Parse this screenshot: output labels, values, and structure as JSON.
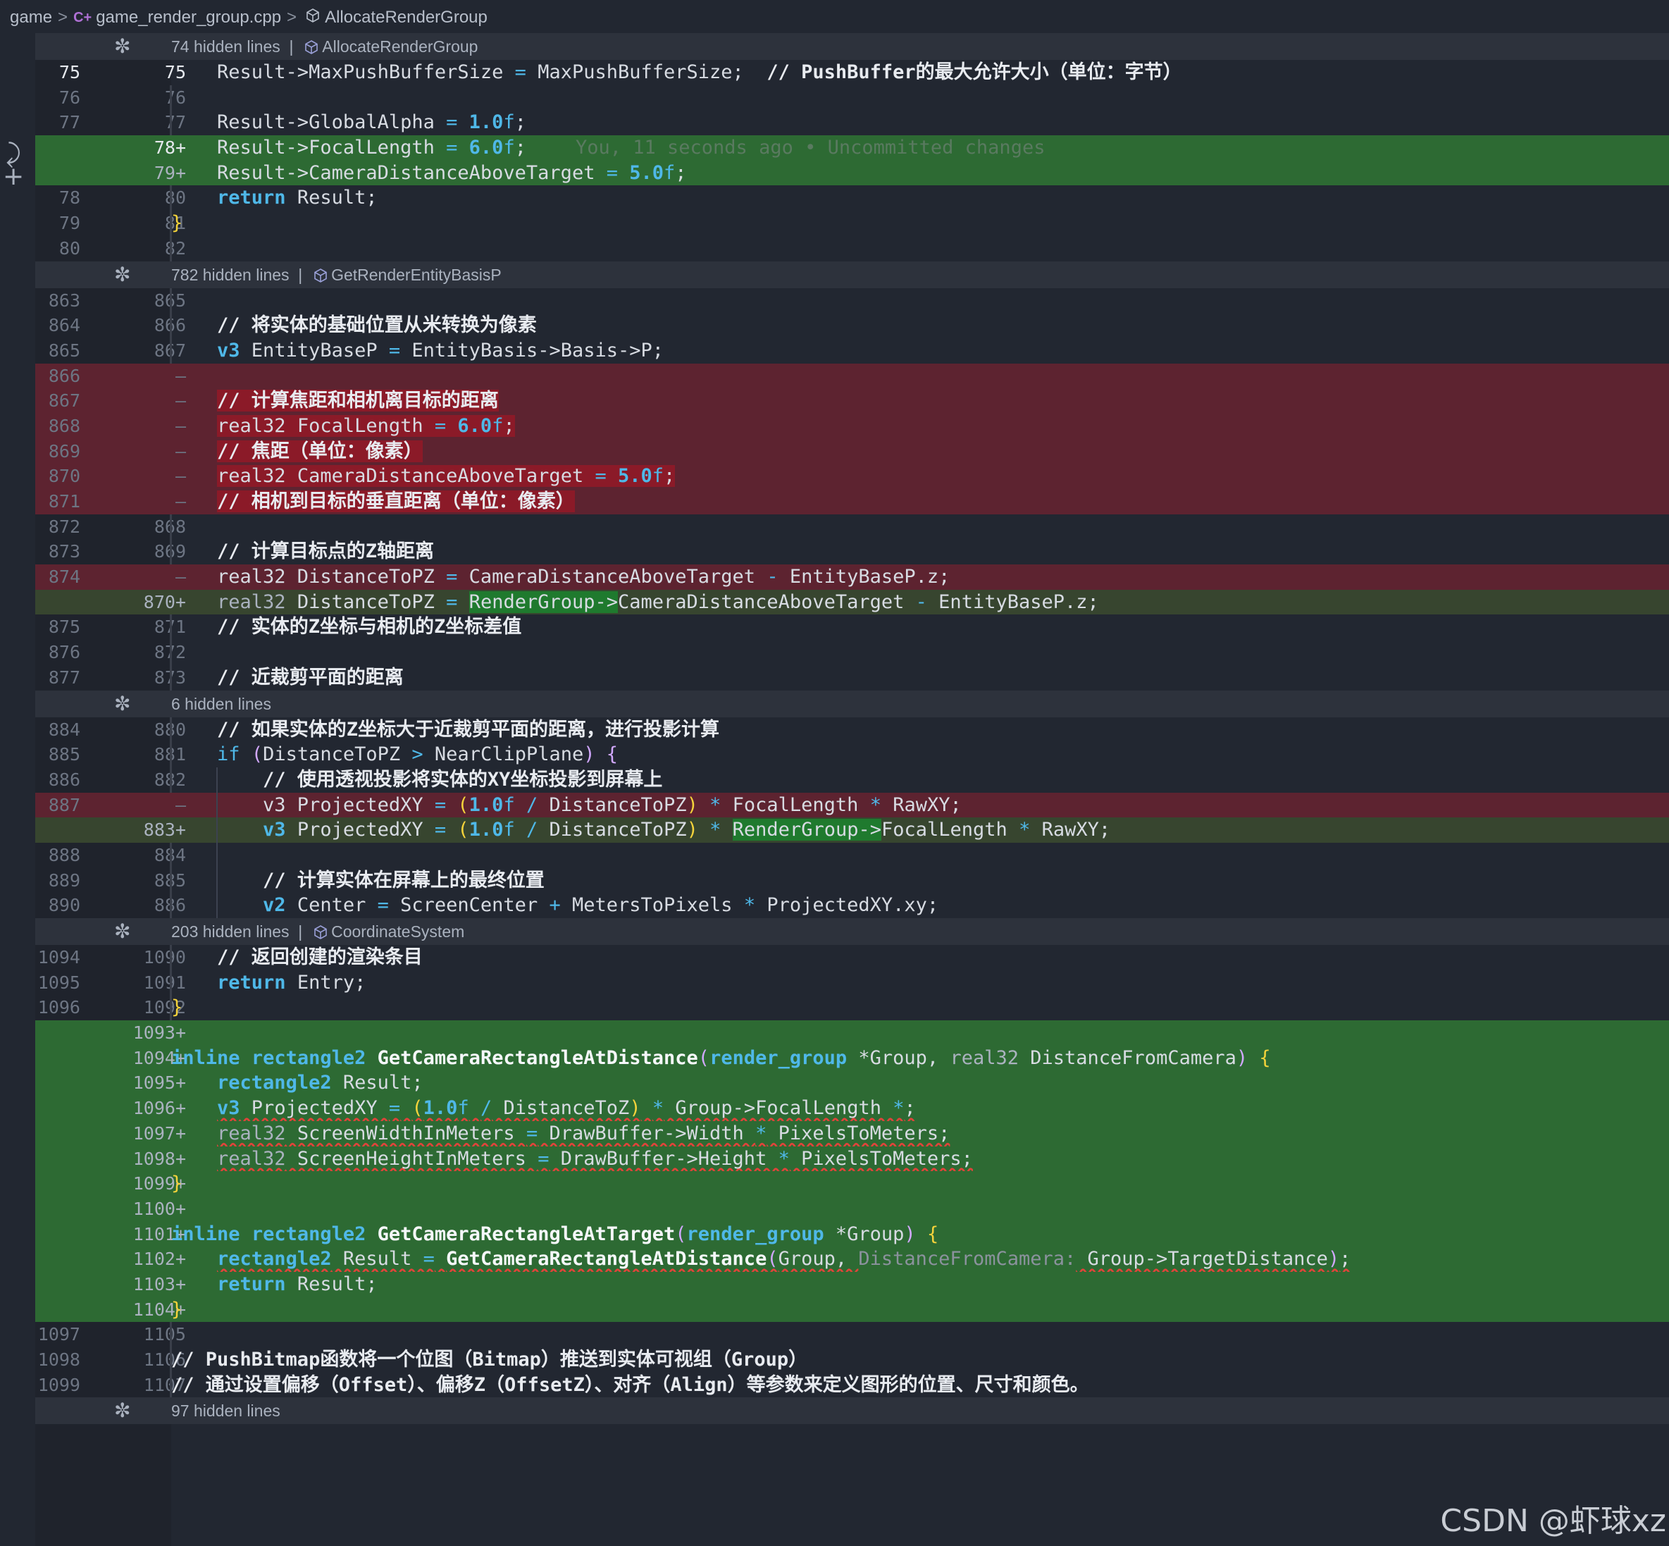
{
  "breadcrumb": {
    "folder": "game",
    "file": "game_render_group.cpp",
    "symbol": "AllocateRenderGroup"
  },
  "watermark": "CSDN @虾球xz",
  "rows": [
    {
      "type": "hidden",
      "text": "74 hidden lines",
      "symbol": "AllocateRenderGroup"
    },
    {
      "type": "ctx",
      "old": "75",
      "new": "75",
      "cur": true,
      "tokens": [
        [
          "",
          "    Result->MaxPushBufferSize "
        ],
        [
          "op",
          "="
        ],
        [
          "",
          " MaxPushBufferSize;  "
        ],
        [
          "cm",
          "// PushBuffer的最大允许大小（单位：字节）"
        ]
      ]
    },
    {
      "type": "ctx",
      "old": "76",
      "new": "76",
      "tokens": []
    },
    {
      "type": "ctx",
      "old": "77",
      "new": "77",
      "tokens": [
        [
          "",
          "    Result->GlobalAlpha "
        ],
        [
          "op",
          "="
        ],
        [
          "",
          " "
        ],
        [
          "num",
          "1.0"
        ],
        [
          "f",
          "f"
        ],
        [
          "",
          ";"
        ]
      ]
    },
    {
      "type": "add",
      "old": "",
      "new": "78+",
      "cur": true,
      "tokens": [
        [
          "",
          "    Result->FocalLength "
        ],
        [
          "op",
          "="
        ],
        [
          "",
          " "
        ],
        [
          "num",
          "6.0"
        ],
        [
          "f",
          "f"
        ],
        [
          "",
          ";"
        ],
        [
          "blame",
          "You, 11 seconds ago • Uncommitted changes"
        ]
      ]
    },
    {
      "type": "add",
      "old": "",
      "new": "79+",
      "tokens": [
        [
          "",
          "    Result->CameraDistanceAboveTarget "
        ],
        [
          "op",
          "="
        ],
        [
          "",
          " "
        ],
        [
          "num",
          "5.0"
        ],
        [
          "f",
          "f"
        ],
        [
          "",
          ";"
        ]
      ]
    },
    {
      "type": "ctx",
      "old": "78",
      "new": "80",
      "tokens": [
        [
          "",
          "    "
        ],
        [
          "kw",
          "return"
        ],
        [
          "",
          " Result;"
        ]
      ]
    },
    {
      "type": "ctx",
      "old": "79",
      "new": "81",
      "tokens": [
        [
          "br",
          "}"
        ]
      ]
    },
    {
      "type": "ctx",
      "old": "80",
      "new": "82",
      "tokens": []
    },
    {
      "type": "hidden",
      "text": "782 hidden lines",
      "symbol": "GetRenderEntityBasisP"
    },
    {
      "type": "ctx",
      "old": "863",
      "new": "865",
      "tokens": []
    },
    {
      "type": "ctx",
      "old": "864",
      "new": "866",
      "tokens": [
        [
          "",
          "    "
        ],
        [
          "cm",
          "// 将实体的基础位置从米转换为像素"
        ]
      ]
    },
    {
      "type": "ctx",
      "old": "865",
      "new": "867",
      "tokens": [
        [
          "",
          "    "
        ],
        [
          "kw",
          "v3"
        ],
        [
          "",
          " EntityBaseP "
        ],
        [
          "op",
          "="
        ],
        [
          "",
          " EntityBasis->Basis->P;"
        ]
      ]
    },
    {
      "type": "del",
      "old": "866",
      "new": "—",
      "tokens": []
    },
    {
      "type": "del",
      "old": "867",
      "new": "—",
      "tokens": [
        [
          "",
          "    "
        ],
        [
          "cm hl-del",
          "// 计算焦距和相机离目标的距离"
        ]
      ]
    },
    {
      "type": "del",
      "old": "868",
      "new": "—",
      "tokens": [
        [
          "",
          "    "
        ],
        [
          "hl-del",
          "real32 FocalLength "
        ],
        [
          "op hl-del",
          "="
        ],
        [
          "hl-del",
          " "
        ],
        [
          "num hl-del",
          "6.0"
        ],
        [
          "f hl-del",
          "f"
        ],
        [
          "hl-del",
          ";"
        ]
      ]
    },
    {
      "type": "del",
      "old": "869",
      "new": "—",
      "tokens": [
        [
          "",
          "    "
        ],
        [
          "cm hl-del",
          "// 焦距（单位：像素）"
        ]
      ]
    },
    {
      "type": "del",
      "old": "870",
      "new": "—",
      "tokens": [
        [
          "",
          "    "
        ],
        [
          "hl-del",
          "real32 CameraDistanceAboveTarget "
        ],
        [
          "op hl-del",
          "="
        ],
        [
          "hl-del",
          " "
        ],
        [
          "num hl-del",
          "5.0"
        ],
        [
          "f hl-del",
          "f"
        ],
        [
          "hl-del",
          ";"
        ]
      ]
    },
    {
      "type": "del",
      "old": "871",
      "new": "—",
      "tokens": [
        [
          "",
          "    "
        ],
        [
          "cm hl-del",
          "// 相机到目标的垂直距离（单位：像素）"
        ]
      ]
    },
    {
      "type": "ctx",
      "old": "872",
      "new": "868",
      "tokens": []
    },
    {
      "type": "ctx",
      "old": "873",
      "new": "869",
      "tokens": [
        [
          "",
          "    "
        ],
        [
          "cm",
          "// 计算目标点的Z轴距离"
        ]
      ]
    },
    {
      "type": "mdel",
      "old": "874",
      "new": "—",
      "tokens": [
        [
          "",
          "    real32 DistanceToPZ "
        ],
        [
          "op",
          "="
        ],
        [
          "",
          " CameraDistanceAboveTarget "
        ],
        [
          "op",
          "-"
        ],
        [
          "",
          " EntityBaseP.z;"
        ]
      ]
    },
    {
      "type": "madd",
      "old": "",
      "new": "870+",
      "tokens": [
        [
          "",
          "    "
        ],
        [
          "dim",
          "real32"
        ],
        [
          "",
          " DistanceToPZ "
        ],
        [
          "op",
          "="
        ],
        [
          "",
          " "
        ],
        [
          "hl-add",
          "RenderGroup->"
        ],
        [
          "",
          "CameraDistanceAboveTarget "
        ],
        [
          "op",
          "-"
        ],
        [
          "",
          " EntityBaseP.z;"
        ]
      ]
    },
    {
      "type": "ctx",
      "old": "875",
      "new": "871",
      "tokens": [
        [
          "",
          "    "
        ],
        [
          "cm",
          "// 实体的Z坐标与相机的Z坐标差值"
        ]
      ]
    },
    {
      "type": "ctx",
      "old": "876",
      "new": "872",
      "tokens": []
    },
    {
      "type": "ctx",
      "old": "877",
      "new": "873",
      "tokens": [
        [
          "",
          "    "
        ],
        [
          "cm",
          "// 近裁剪平面的距离"
        ]
      ]
    },
    {
      "type": "hidden",
      "text": "6 hidden lines",
      "symbol": ""
    },
    {
      "type": "ctx",
      "old": "884",
      "new": "880",
      "tokens": [
        [
          "",
          "    "
        ],
        [
          "cm",
          "// 如果实体的Z坐标大于近裁剪平面的距离，进行投影计算"
        ]
      ]
    },
    {
      "type": "ctx",
      "old": "885",
      "new": "881",
      "tokens": [
        [
          "",
          "    "
        ],
        [
          "ty",
          "if"
        ],
        [
          "",
          " "
        ],
        [
          "pa",
          "("
        ],
        [
          "",
          "DistanceToPZ "
        ],
        [
          "op",
          ">"
        ],
        [
          "",
          " NearClipPlane"
        ],
        [
          "pa",
          ")"
        ],
        [
          "",
          " "
        ],
        [
          "pa",
          "{"
        ]
      ]
    },
    {
      "type": "ctx",
      "old": "886",
      "new": "882",
      "guide": true,
      "tokens": [
        [
          "",
          "        "
        ],
        [
          "cm",
          "// 使用透视投影将实体的XY坐标投影到屏幕上"
        ]
      ]
    },
    {
      "type": "mdel",
      "old": "887",
      "new": "—",
      "guide": true,
      "tokens": [
        [
          "",
          "        v3 ProjectedXY "
        ],
        [
          "op",
          "="
        ],
        [
          "",
          " "
        ],
        [
          "br",
          "("
        ],
        [
          "num",
          "1.0"
        ],
        [
          "f",
          "f"
        ],
        [
          "",
          " "
        ],
        [
          "op",
          "/"
        ],
        [
          "",
          " DistanceToPZ"
        ],
        [
          "br",
          ")"
        ],
        [
          "",
          " "
        ],
        [
          "op",
          "*"
        ],
        [
          "",
          " FocalLength "
        ],
        [
          "op",
          "*"
        ],
        [
          "",
          " RawXY;"
        ]
      ]
    },
    {
      "type": "madd",
      "old": "",
      "new": "883+",
      "guide": true,
      "tokens": [
        [
          "",
          "        "
        ],
        [
          "kw",
          "v3"
        ],
        [
          "",
          " ProjectedXY "
        ],
        [
          "op",
          "="
        ],
        [
          "",
          " "
        ],
        [
          "br",
          "("
        ],
        [
          "num",
          "1.0"
        ],
        [
          "f",
          "f"
        ],
        [
          "",
          " "
        ],
        [
          "op",
          "/"
        ],
        [
          "",
          " DistanceToPZ"
        ],
        [
          "br",
          ")"
        ],
        [
          "",
          " "
        ],
        [
          "op",
          "*"
        ],
        [
          "",
          " "
        ],
        [
          "hl-add",
          "RenderGroup->"
        ],
        [
          "",
          "FocalLength "
        ],
        [
          "op",
          "*"
        ],
        [
          "",
          " RawXY;"
        ]
      ]
    },
    {
      "type": "ctx",
      "old": "888",
      "new": "884",
      "guide": true,
      "tokens": []
    },
    {
      "type": "ctx",
      "old": "889",
      "new": "885",
      "guide": true,
      "tokens": [
        [
          "",
          "        "
        ],
        [
          "cm",
          "// 计算实体在屏幕上的最终位置"
        ]
      ]
    },
    {
      "type": "ctx",
      "old": "890",
      "new": "886",
      "guide": true,
      "tokens": [
        [
          "",
          "        "
        ],
        [
          "kw",
          "v2"
        ],
        [
          "",
          " Center "
        ],
        [
          "op",
          "="
        ],
        [
          "",
          " ScreenCenter "
        ],
        [
          "op",
          "+"
        ],
        [
          "",
          " MetersToPixels "
        ],
        [
          "op",
          "*"
        ],
        [
          "",
          " ProjectedXY.xy;"
        ]
      ]
    },
    {
      "type": "hidden",
      "text": "203 hidden lines",
      "symbol": "CoordinateSystem"
    },
    {
      "type": "ctx",
      "old": "1094",
      "new": "1090",
      "tokens": [
        [
          "",
          "    "
        ],
        [
          "cm",
          "// 返回创建的渲染条目"
        ]
      ]
    },
    {
      "type": "ctx",
      "old": "1095",
      "new": "1091",
      "tokens": [
        [
          "",
          "    "
        ],
        [
          "kw",
          "return"
        ],
        [
          "",
          " Entry;"
        ]
      ]
    },
    {
      "type": "ctx",
      "old": "1096",
      "new": "1092",
      "tokens": [
        [
          "br",
          "}"
        ]
      ]
    },
    {
      "type": "add",
      "old": "",
      "new": "1093+",
      "tokens": []
    },
    {
      "type": "add",
      "old": "",
      "new": "1094+",
      "tokens": [
        [
          "kw",
          "inline"
        ],
        [
          "",
          " "
        ],
        [
          "kw",
          "rectangle2"
        ],
        [
          "",
          " "
        ],
        [
          "fn",
          "GetCameraRectangleAtDistance"
        ],
        [
          "pa",
          "("
        ],
        [
          "kw",
          "render_group"
        ],
        [
          "",
          " *Group, "
        ],
        [
          "dim",
          "real32"
        ],
        [
          "",
          " DistanceFromCamera"
        ],
        [
          "pa",
          ")"
        ],
        [
          "",
          " "
        ],
        [
          "br",
          "{"
        ]
      ]
    },
    {
      "type": "add",
      "old": "",
      "new": "1095+",
      "tokens": [
        [
          "",
          "    "
        ],
        [
          "kw",
          "rectangle2"
        ],
        [
          "",
          " Result;"
        ]
      ]
    },
    {
      "type": "add",
      "old": "",
      "new": "1096+",
      "squig": true,
      "tokens": [
        [
          "",
          "    "
        ],
        [
          "kw",
          "v3"
        ],
        [
          "",
          " ProjectedXY "
        ],
        [
          "op",
          "="
        ],
        [
          "",
          " "
        ],
        [
          "br",
          "("
        ],
        [
          "num",
          "1.0"
        ],
        [
          "f",
          "f"
        ],
        [
          "",
          " "
        ],
        [
          "op",
          "/"
        ],
        [
          "",
          " DistanceToZ"
        ],
        [
          "br",
          ")"
        ],
        [
          "",
          " "
        ],
        [
          "op",
          "*"
        ],
        [
          "",
          " Group->FocalLength "
        ],
        [
          "op",
          "*"
        ],
        [
          "",
          ";"
        ]
      ]
    },
    {
      "type": "add",
      "old": "",
      "new": "1097+",
      "squig": true,
      "tokens": [
        [
          "",
          "    "
        ],
        [
          "dim",
          "real32"
        ],
        [
          "",
          " ScreenWidthInMeters "
        ],
        [
          "op",
          "="
        ],
        [
          "",
          " DrawBuffer->Width "
        ],
        [
          "op",
          "*"
        ],
        [
          "",
          " PixelsToMeters;"
        ]
      ]
    },
    {
      "type": "add",
      "old": "",
      "new": "1098+",
      "squig": true,
      "tokens": [
        [
          "",
          "    "
        ],
        [
          "dim",
          "real32"
        ],
        [
          "",
          " ScreenHeightInMeters "
        ],
        [
          "op",
          "="
        ],
        [
          "",
          " DrawBuffer->Height "
        ],
        [
          "op",
          "*"
        ],
        [
          "",
          " PixelsToMeters;"
        ]
      ]
    },
    {
      "type": "add",
      "old": "",
      "new": "1099+",
      "tokens": [
        [
          "br",
          "}"
        ]
      ]
    },
    {
      "type": "add",
      "old": "",
      "new": "1100+",
      "tokens": []
    },
    {
      "type": "add",
      "old": "",
      "new": "1101+",
      "tokens": [
        [
          "kw",
          "inline"
        ],
        [
          "",
          " "
        ],
        [
          "kw",
          "rectangle2"
        ],
        [
          "",
          " "
        ],
        [
          "fn",
          "GetCameraRectangleAtTarget"
        ],
        [
          "pa",
          "("
        ],
        [
          "kw",
          "render_group"
        ],
        [
          "",
          " *Group"
        ],
        [
          "pa",
          ")"
        ],
        [
          "",
          " "
        ],
        [
          "br",
          "{"
        ]
      ]
    },
    {
      "type": "add",
      "old": "",
      "new": "1102+",
      "squig": true,
      "tokens": [
        [
          "",
          "    "
        ],
        [
          "kw",
          "rectangle2"
        ],
        [
          "",
          " Result "
        ],
        [
          "op",
          "="
        ],
        [
          "",
          " "
        ],
        [
          "fn",
          "GetCameraRectangleAtDistance"
        ],
        [
          "pa",
          "("
        ],
        [
          "",
          "Group, "
        ],
        [
          "hint",
          "DistanceFromCamera:"
        ],
        [
          "",
          " Group->TargetDistance"
        ],
        [
          "pa",
          ")"
        ],
        [
          "",
          ";"
        ]
      ]
    },
    {
      "type": "add",
      "old": "",
      "new": "1103+",
      "tokens": [
        [
          "",
          "    "
        ],
        [
          "kw",
          "return"
        ],
        [
          "",
          " Result;"
        ]
      ]
    },
    {
      "type": "add",
      "old": "",
      "new": "1104+",
      "tokens": [
        [
          "br",
          "}"
        ]
      ]
    },
    {
      "type": "ctx",
      "old": "1097",
      "new": "1105",
      "tokens": []
    },
    {
      "type": "ctx",
      "old": "1098",
      "new": "1106",
      "tokens": [
        [
          "cm",
          "// PushBitmap函数将一个位图（Bitmap）推送到实体可视组（Group）"
        ]
      ]
    },
    {
      "type": "ctx",
      "old": "1099",
      "new": "1107",
      "tokens": [
        [
          "cm",
          "// 通过设置偏移（Offset）、偏移Z（OffsetZ）、对齐（Align）等参数来定义图形的位置、尺寸和颜色。"
        ]
      ]
    },
    {
      "type": "hidden",
      "text": "97 hidden lines",
      "symbol": ""
    }
  ]
}
